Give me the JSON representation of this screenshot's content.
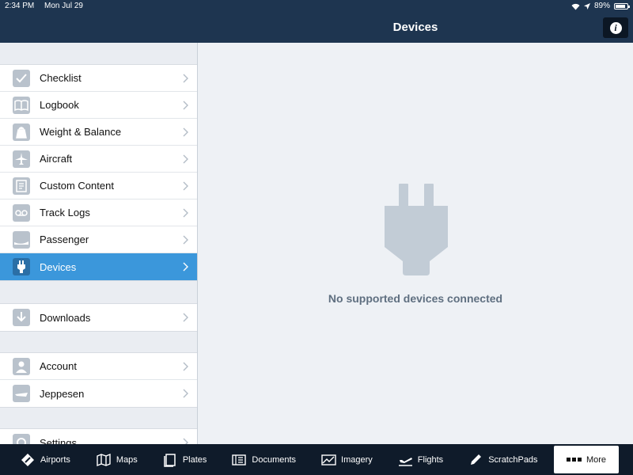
{
  "status": {
    "time": "2:34 PM",
    "date": "Mon Jul 29",
    "battery": "89%",
    "battery_level": 0.89
  },
  "header": {
    "title": "Devices"
  },
  "sidebar": {
    "group1": [
      {
        "label": "Checklist",
        "icon": "checkmark-icon"
      },
      {
        "label": "Logbook",
        "icon": "book-icon"
      },
      {
        "label": "Weight & Balance",
        "icon": "weight-icon"
      },
      {
        "label": "Aircraft",
        "icon": "airplane-icon"
      },
      {
        "label": "Custom Content",
        "icon": "document-icon"
      },
      {
        "label": "Track Logs",
        "icon": "track-logs-icon"
      },
      {
        "label": "Passenger",
        "icon": "passenger-icon"
      },
      {
        "label": "Devices",
        "icon": "plug-icon",
        "active": true
      }
    ],
    "group2": [
      {
        "label": "Downloads",
        "icon": "download-icon"
      }
    ],
    "group3": [
      {
        "label": "Account",
        "icon": "person-icon"
      },
      {
        "label": "Jeppesen",
        "icon": "jeppesen-icon"
      }
    ],
    "group4": [
      {
        "label": "Settings",
        "icon": "gear-icon"
      }
    ]
  },
  "main": {
    "empty_message": "No supported devices connected"
  },
  "tabbar": [
    {
      "label": "Airports",
      "icon": "airports-icon"
    },
    {
      "label": "Maps",
      "icon": "map-icon"
    },
    {
      "label": "Plates",
      "icon": "plates-icon"
    },
    {
      "label": "Documents",
      "icon": "documents-icon"
    },
    {
      "label": "Imagery",
      "icon": "imagery-icon"
    },
    {
      "label": "Flights",
      "icon": "flights-icon"
    },
    {
      "label": "ScratchPads",
      "icon": "pencil-icon"
    },
    {
      "label": "More",
      "icon": "more-icon"
    }
  ],
  "colors": {
    "nav_bg": "#1e3550",
    "accent": "#3b97db",
    "tabbar_bg": "#0f1b2a"
  }
}
